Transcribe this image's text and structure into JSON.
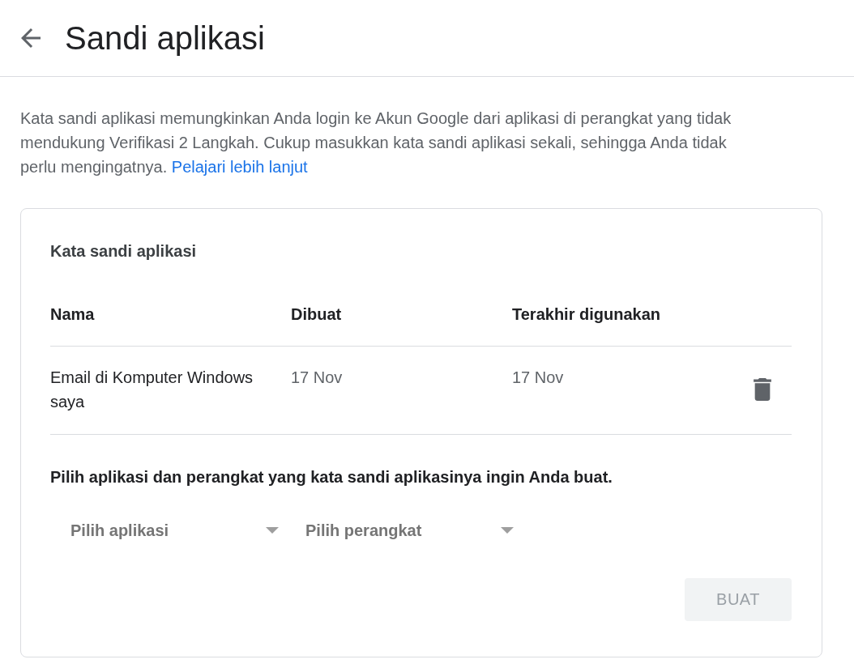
{
  "header": {
    "title": "Sandi aplikasi"
  },
  "intro": {
    "text": "Kata sandi aplikasi memungkinkan Anda login ke Akun Google dari aplikasi di perangkat yang tidak mendukung Verifikasi 2 Langkah. Cukup masukkan kata sandi aplikasi sekali, sehingga Anda tidak perlu mengingatnya.",
    "link": "Pelajari lebih lanjut"
  },
  "card": {
    "title": "Kata sandi aplikasi",
    "table": {
      "columns": [
        "Nama",
        "Dibuat",
        "Terakhir digunakan"
      ],
      "rows": [
        {
          "cells": [
            "Email di Komputer Windows saya",
            "17 Nov",
            "17 Nov"
          ]
        }
      ]
    },
    "instruction": "Pilih aplikasi dan perangkat yang kata sandi aplikasinya ingin Anda buat.",
    "dropdowns": [
      {
        "placeholder": "Pilih aplikasi"
      },
      {
        "placeholder": "Pilih perangkat"
      }
    ],
    "create_button": {
      "label": "BUAT",
      "disabled": true
    }
  }
}
